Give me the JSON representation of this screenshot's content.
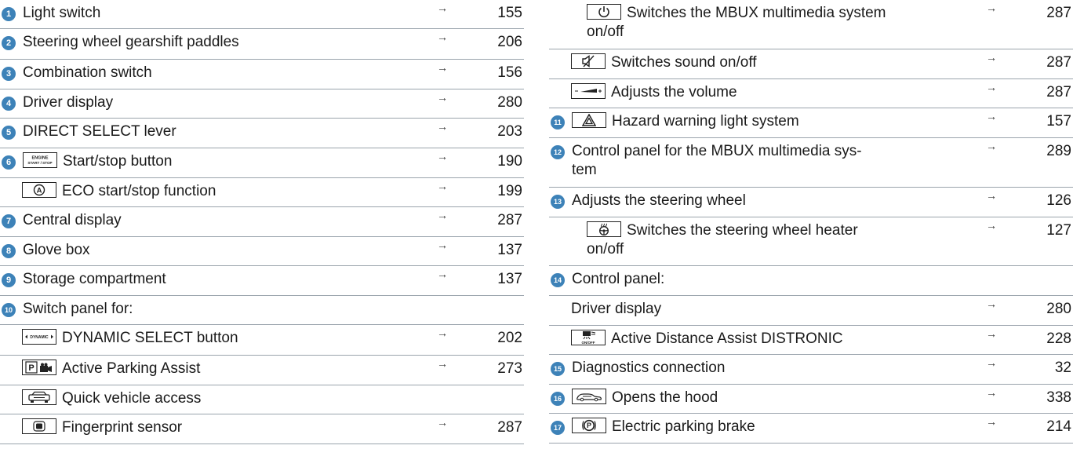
{
  "left_items": [
    {
      "id": "l1",
      "num": "1",
      "label": "Light switch",
      "page": "155"
    },
    {
      "id": "l2",
      "num": "2",
      "label": "Steering wheel gearshift paddles",
      "page": "206"
    },
    {
      "id": "l3",
      "num": "3",
      "label": "Combination switch",
      "page": "156"
    },
    {
      "id": "l4",
      "num": "4",
      "label": "Driver display",
      "page": "280"
    },
    {
      "id": "l5",
      "num": "5",
      "label": "DIRECT SELECT lever",
      "page": "203"
    },
    {
      "id": "l6",
      "num": "6",
      "icon": "engine-start-stop-icon",
      "icon_text": "ENGINE START / STOP",
      "label": "Start/stop button",
      "page": "190"
    },
    {
      "id": "l6b",
      "icon": "eco-start-stop-icon",
      "label": "ECO start/stop function",
      "page": "199"
    },
    {
      "id": "l7",
      "num": "7",
      "label": "Central display",
      "page": "287"
    },
    {
      "id": "l8",
      "num": "8",
      "label": "Glove box",
      "page": "137"
    },
    {
      "id": "l9",
      "num": "9",
      "label": "Storage compartment",
      "page": "137"
    },
    {
      "id": "l10",
      "num": "10",
      "label": "Switch panel for:",
      "page": ""
    },
    {
      "id": "l10a",
      "icon": "dynamic-select-icon",
      "icon_text": "DYNAMIC",
      "label": "DYNAMIC SELECT button",
      "page": "202"
    },
    {
      "id": "l10b",
      "icon": "parking-camera-icon",
      "label": "Active Parking Assist",
      "page": "273"
    },
    {
      "id": "l10c",
      "icon": "car-front-icon",
      "label": "Quick vehicle access",
      "page": ""
    },
    {
      "id": "l10d",
      "icon": "fingerprint-sensor-icon",
      "label": "Fingerprint sensor",
      "page": "287"
    }
  ],
  "right_items": [
    {
      "id": "r1",
      "icon": "power-icon",
      "label_line1": "Switches the MBUX multimedia system",
      "label_line2": "on/off",
      "page": "287"
    },
    {
      "id": "r2",
      "icon": "mute-icon",
      "label": "Switches sound on/off",
      "page": "287"
    },
    {
      "id": "r3",
      "icon": "volume-icon",
      "label": "Adjusts the volume",
      "page": "287"
    },
    {
      "id": "r11",
      "num": "11",
      "icon": "hazard-icon",
      "label": "Hazard warning light system",
      "page": "157"
    },
    {
      "id": "r12",
      "num": "12",
      "label_line1": "Control panel for the MBUX multimedia sys-",
      "label_line2": "tem",
      "page": "289"
    },
    {
      "id": "r13",
      "num": "13",
      "label": "Adjusts the steering wheel",
      "page": "126"
    },
    {
      "id": "r13b",
      "icon": "steering-heater-icon",
      "label_line1": "Switches the steering wheel heater",
      "label_line2": "on/off",
      "page": "127"
    },
    {
      "id": "r14",
      "num": "14",
      "label": "Control panel:",
      "page": ""
    },
    {
      "id": "r14a",
      "label": "Driver display",
      "page": "280"
    },
    {
      "id": "r14b",
      "icon": "distronic-icon",
      "icon_text": "ON/OFF",
      "label": "Active Distance Assist DISTRONIC",
      "page": "228"
    },
    {
      "id": "r15",
      "num": "15",
      "label": "Diagnostics connection",
      "page": "32"
    },
    {
      "id": "r16",
      "num": "16",
      "icon": "hood-icon",
      "label": "Opens the hood",
      "page": "338"
    },
    {
      "id": "r17",
      "num": "17",
      "icon": "parking-brake-icon",
      "label": "Electric parking brake",
      "page": "214"
    }
  ],
  "arrow_glyph": "→",
  "colors": {
    "badge": "#3d82b8",
    "rule": "#9aa3ac",
    "text": "#1a1a1a"
  }
}
